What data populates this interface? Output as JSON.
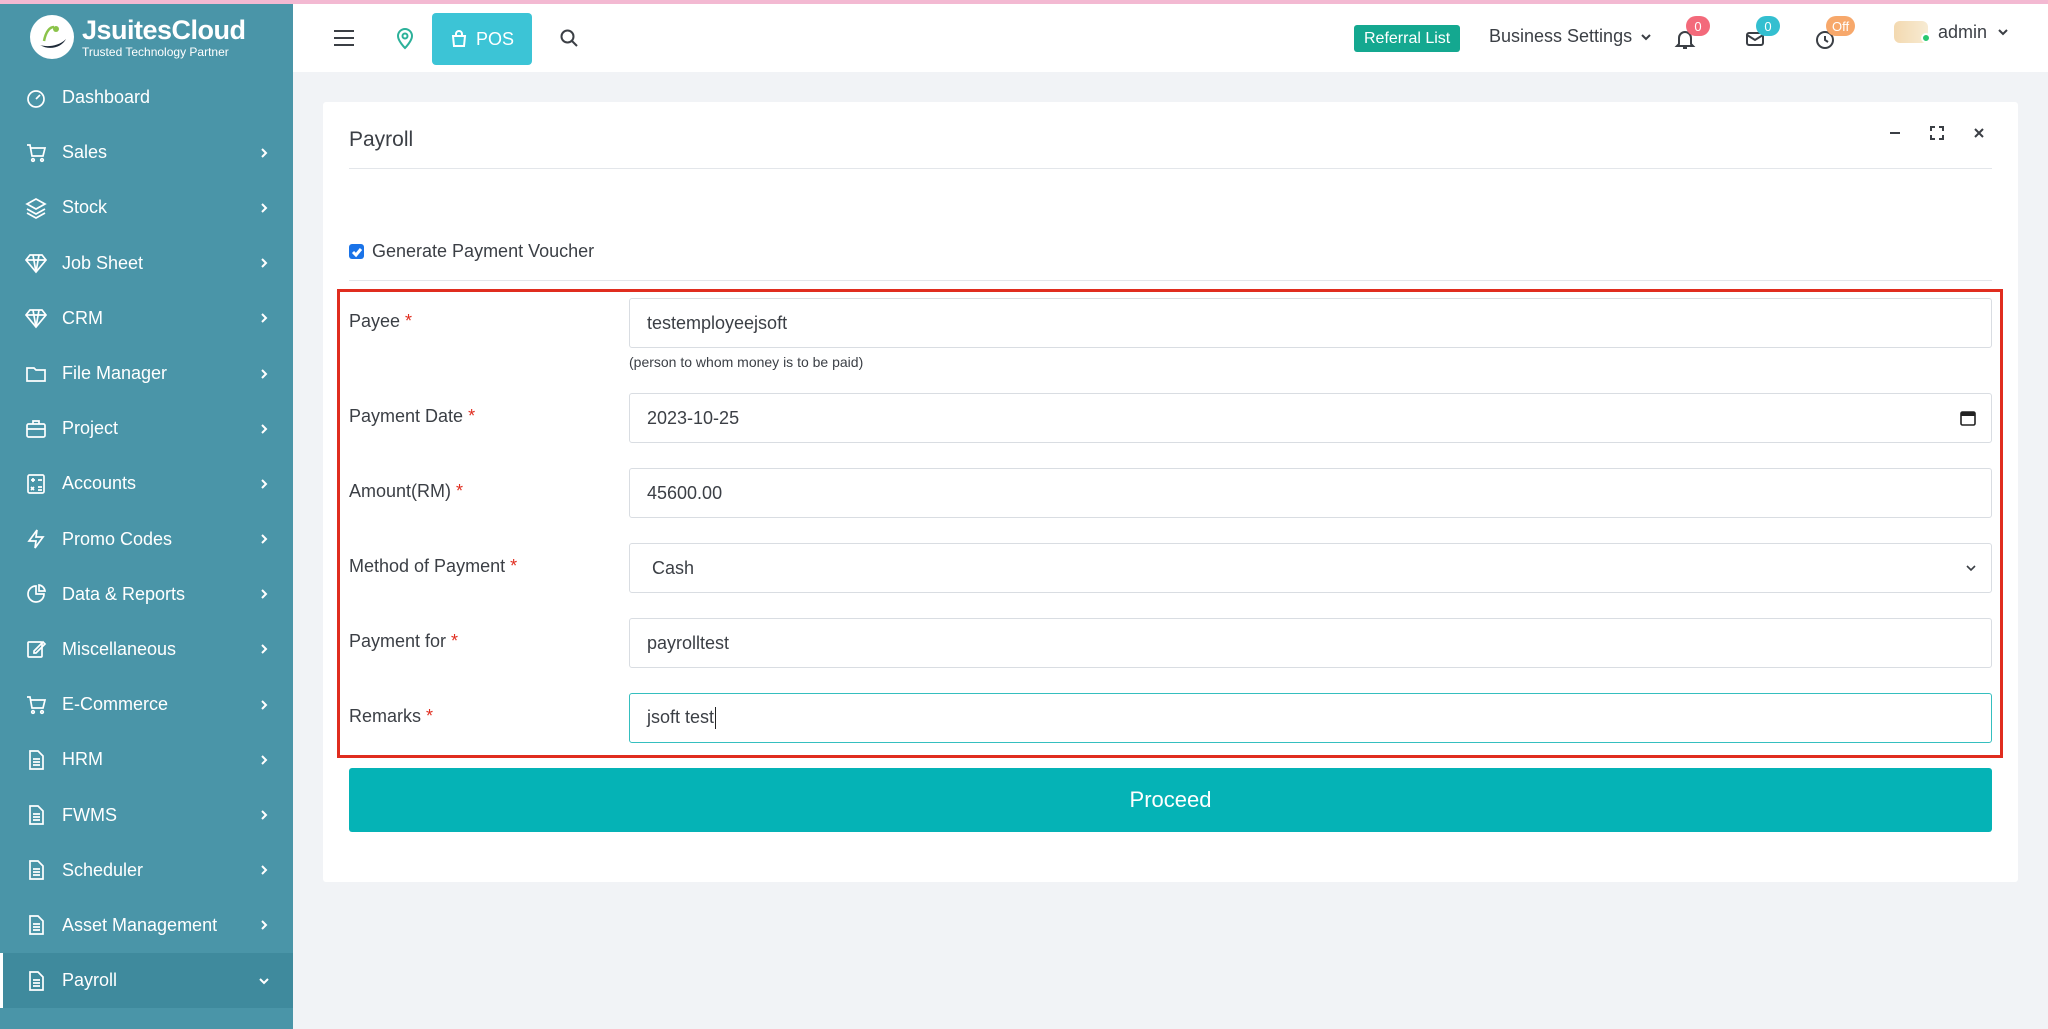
{
  "brand": {
    "name": "JsuitesCloud",
    "tagline": "Trusted Technology Partner"
  },
  "sidebar": {
    "items": [
      {
        "label": "Dashboard",
        "icon": "dashboard-gauge-icon",
        "has_children": false
      },
      {
        "label": "Sales",
        "icon": "shopping-cart-icon",
        "has_children": true
      },
      {
        "label": "Stock",
        "icon": "layers-icon",
        "has_children": true
      },
      {
        "label": "Job Sheet",
        "icon": "diamond-icon",
        "has_children": true
      },
      {
        "label": "CRM",
        "icon": "diamond-icon",
        "has_children": true
      },
      {
        "label": "File Manager",
        "icon": "folder-icon",
        "has_children": true
      },
      {
        "label": "Project",
        "icon": "briefcase-icon",
        "has_children": true
      },
      {
        "label": "Accounts",
        "icon": "calculator-icon",
        "has_children": true
      },
      {
        "label": "Promo Codes",
        "icon": "lightning-icon",
        "has_children": true
      },
      {
        "label": "Data & Reports",
        "icon": "pie-chart-icon",
        "has_children": true
      },
      {
        "label": "Miscellaneous",
        "icon": "edit-icon",
        "has_children": true
      },
      {
        "label": "E-Commerce",
        "icon": "shopping-cart-icon",
        "has_children": true
      },
      {
        "label": "HRM",
        "icon": "document-icon",
        "has_children": true
      },
      {
        "label": "FWMS",
        "icon": "document-icon",
        "has_children": true
      },
      {
        "label": "Scheduler",
        "icon": "document-icon",
        "has_children": true
      },
      {
        "label": "Asset Management",
        "icon": "document-icon",
        "has_children": true
      },
      {
        "label": "Payroll",
        "icon": "document-icon",
        "has_children": true,
        "active": true
      }
    ]
  },
  "topbar": {
    "pos_label": "POS",
    "referral_label": "Referral List",
    "business_settings_label": "Business Settings",
    "notifications_count": "0",
    "messages_count": "0",
    "clock_status": "Off",
    "user_name": "admin"
  },
  "card": {
    "title": "Payroll",
    "voucher_label": "Generate Payment Voucher",
    "voucher_checked": true,
    "fields": {
      "payee": {
        "label": "Payee",
        "value": "testemployeejsoft",
        "help": "(person to whom money is to be paid)"
      },
      "payment_date": {
        "label": "Payment Date",
        "value": "2023-10-25"
      },
      "amount": {
        "label": "Amount(RM)",
        "value": "45600.00"
      },
      "method": {
        "label": "Method of Payment",
        "value": "Cash"
      },
      "payment_for": {
        "label": "Payment for",
        "value": "payrolltest"
      },
      "remarks": {
        "label": "Remarks",
        "value": "jsoft test"
      }
    },
    "required_mark": "*",
    "proceed_label": "Proceed"
  },
  "colors": {
    "sidebar_bg": "#4a95a8",
    "accent_teal": "#05b3b6",
    "pos_button": "#3cc4d6",
    "referral_bg": "#14a890",
    "highlight_border": "#e02d1f",
    "required": "#e02d1f"
  }
}
